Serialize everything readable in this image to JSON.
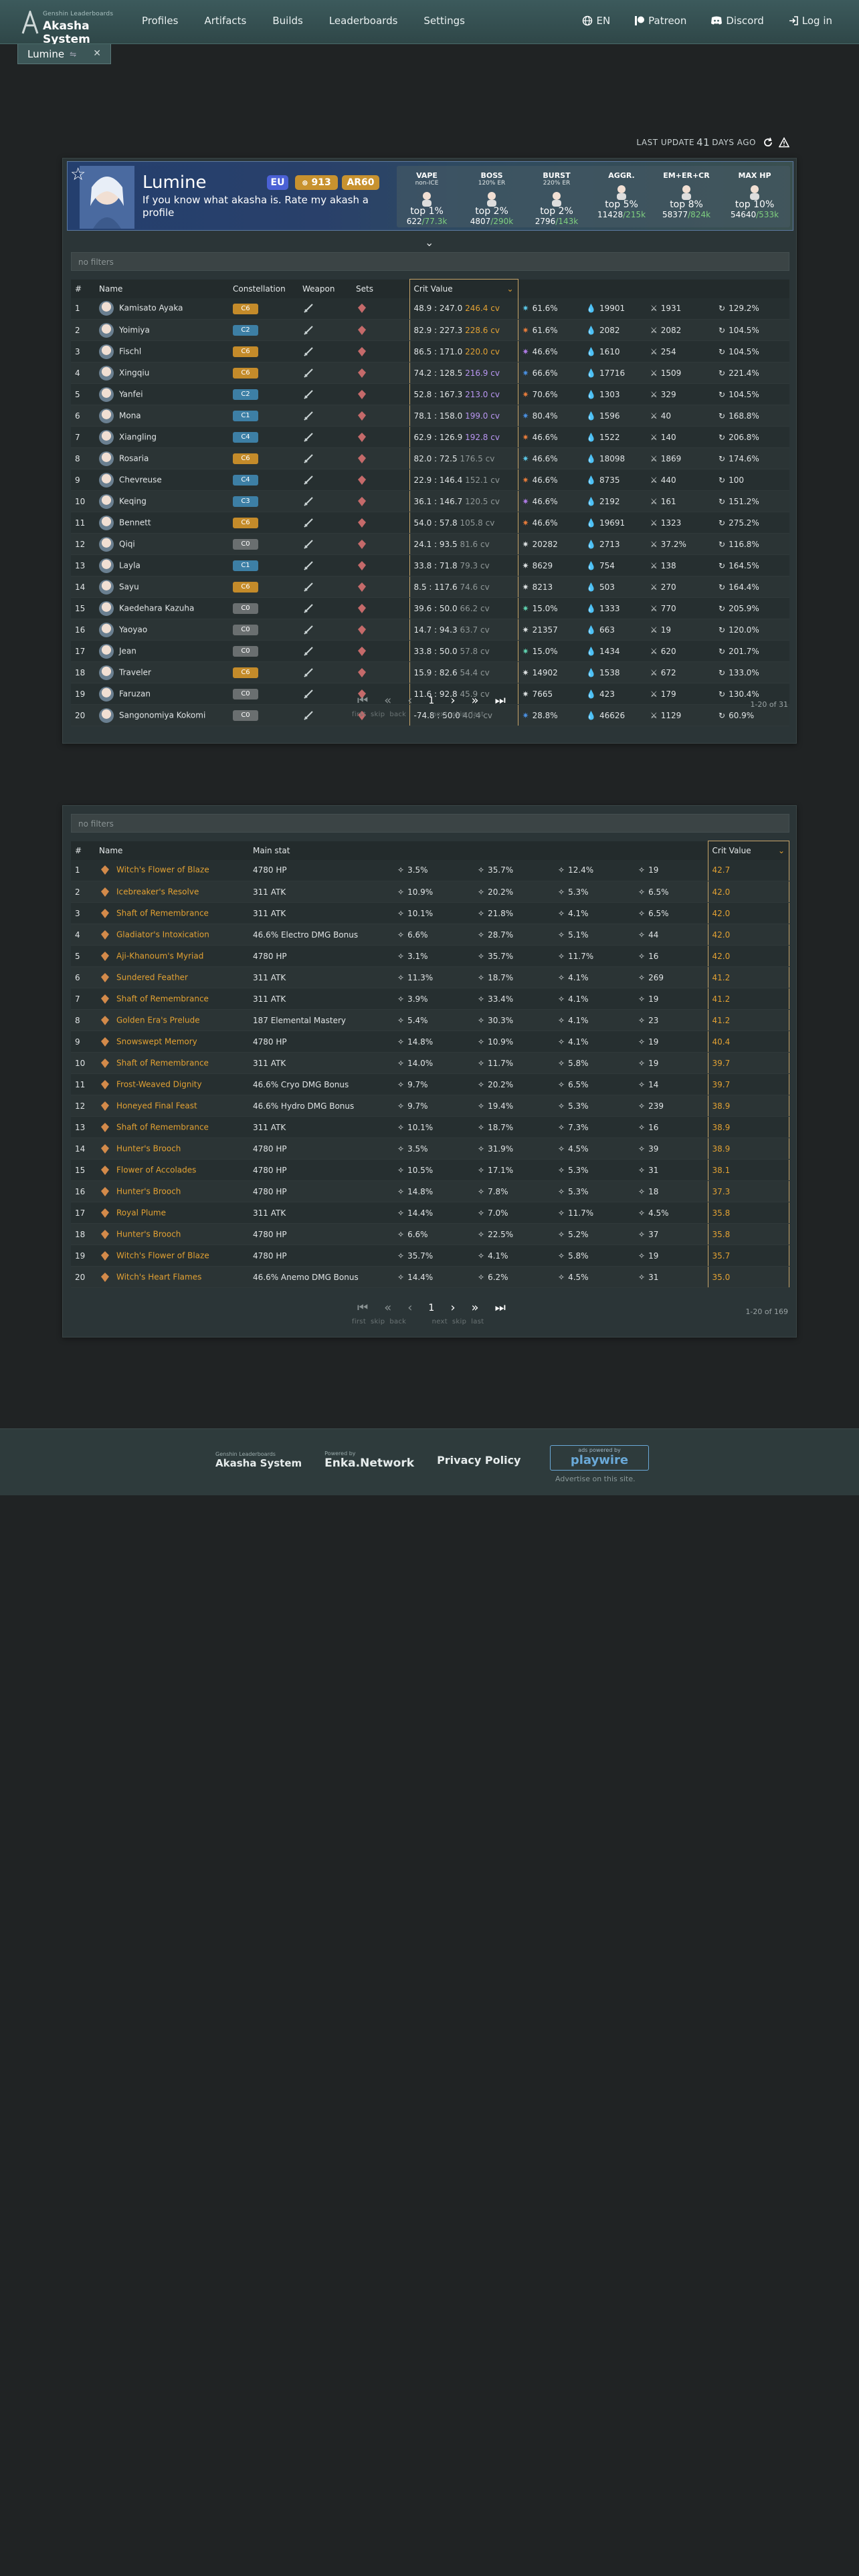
{
  "nav": {
    "logo_sup": "Genshin Leaderboards",
    "logo_main": "Akasha System",
    "links": [
      "Profiles",
      "Artifacts",
      "Builds",
      "Leaderboards",
      "Settings"
    ],
    "right": [
      "EN",
      "Patreon",
      "Discord",
      "Log in"
    ]
  },
  "tab": {
    "label": "Lumine"
  },
  "update": {
    "prefix": "LAST UPDATE",
    "value": "41",
    "suffix": "DAYS AGO"
  },
  "profile": {
    "name": "Lumine",
    "region": "EU",
    "achievements": "913",
    "ar": "AR60",
    "text": "If you know what akasha is. Rate my akash a profile",
    "stats": [
      {
        "title": "VAPE",
        "sub": "non-ICE",
        "top": "top 1%",
        "rank": "622",
        "rank_total": "/77.3k"
      },
      {
        "title": "BOSS",
        "sub": "120% ER",
        "top": "top 2%",
        "rank": "4807",
        "rank_total": "/290k"
      },
      {
        "title": "BURST",
        "sub": "220% ER",
        "top": "top 2%",
        "rank": "2796",
        "rank_total": "/143k"
      },
      {
        "title": "AGGR.",
        "sub": "",
        "top": "top 5%",
        "rank": "11428",
        "rank_total": "/215k"
      },
      {
        "title": "EM+ER+CR",
        "sub": "",
        "top": "top 8%",
        "rank": "58377",
        "rank_total": "/824k"
      },
      {
        "title": "MAX HP",
        "sub": "",
        "top": "top 10%",
        "rank": "54640",
        "rank_total": "/533k"
      }
    ]
  },
  "filter1": "no filters",
  "chars": {
    "headers": [
      "#",
      "Name",
      "Constellation",
      "Weapon",
      "Sets",
      "Crit Value",
      "",
      "",
      "",
      ""
    ],
    "rows": [
      {
        "n": "1",
        "name": "Kamisato Ayaka",
        "c": "C6",
        "cv": "48.9 : 247.0",
        "cvv": "246.4 cv",
        "cvc": "gold",
        "e": "61.6%",
        "hp": "19901",
        "atk": "1931",
        "er": "129.2%",
        "ec": "#5bc8e8"
      },
      {
        "n": "2",
        "name": "Yoimiya",
        "c": "C2",
        "cv": "82.9 : 227.3",
        "cvv": "228.6 cv",
        "cvc": "gold",
        "e": "61.6%",
        "hp": "2082",
        "atk": "2082",
        "er": "104.5%",
        "ec": "#e87c3b"
      },
      {
        "n": "3",
        "name": "Fischl",
        "c": "C6",
        "cv": "86.5 : 171.0",
        "cvv": "220.0 cv",
        "cvc": "gold",
        "e": "46.6%",
        "hp": "1610",
        "atk": "254",
        "er": "104.5%",
        "ec": "#b07be8"
      },
      {
        "n": "4",
        "name": "Xingqiu",
        "c": "C6",
        "cv": "74.2 : 128.5",
        "cvv": "216.9 cv",
        "cvc": "pur",
        "e": "66.6%",
        "hp": "17716",
        "atk": "1509",
        "er": "221.4%",
        "ec": "#4a90e2"
      },
      {
        "n": "5",
        "name": "Yanfei",
        "c": "C2",
        "cv": "52.8 : 167.3",
        "cvv": "213.0 cv",
        "cvc": "pur",
        "e": "70.6%",
        "hp": "1303",
        "atk": "329",
        "er": "104.5%",
        "ec": "#e87c3b"
      },
      {
        "n": "6",
        "name": "Mona",
        "c": "C1",
        "cv": "78.1 : 158.0",
        "cvv": "199.0 cv",
        "cvc": "pur",
        "e": "80.4%",
        "hp": "1596",
        "atk": "40",
        "er": "168.8%",
        "ec": "#4a90e2"
      },
      {
        "n": "7",
        "name": "Xiangling",
        "c": "C4",
        "cv": "62.9 : 126.9",
        "cvv": "192.8 cv",
        "cvc": "pur",
        "e": "46.6%",
        "hp": "1522",
        "atk": "140",
        "er": "206.8%",
        "ec": "#e87c3b"
      },
      {
        "n": "8",
        "name": "Rosaria",
        "c": "C6",
        "cv": "82.0 : 72.5",
        "cvv": "176.5 cv",
        "cvc": "grey",
        "e": "46.6%",
        "hp": "18098",
        "atk": "1869",
        "er": "174.6%",
        "ec": "#5bc8e8"
      },
      {
        "n": "9",
        "name": "Chevreuse",
        "c": "C4",
        "cv": "22.9 : 146.4",
        "cvv": "152.1 cv",
        "cvc": "grey",
        "e": "46.6%",
        "hp": "8735",
        "atk": "440",
        "er": "100",
        "ec": "#e87c3b"
      },
      {
        "n": "10",
        "name": "Keqing",
        "c": "C3",
        "cv": "36.1 : 146.7",
        "cvv": "120.5 cv",
        "cvc": "grey",
        "e": "46.6%",
        "hp": "2192",
        "atk": "161",
        "er": "151.2%",
        "ec": "#b07be8"
      },
      {
        "n": "11",
        "name": "Bennett",
        "c": "C6",
        "cv": "54.0 : 57.8",
        "cvv": "105.8 cv",
        "cvc": "grey",
        "e": "46.6%",
        "hp": "19691",
        "atk": "1323",
        "er": "275.2%",
        "ec": "#e87c3b"
      },
      {
        "n": "12",
        "name": "Qiqi",
        "c": "C0",
        "cv": "24.1 : 93.5",
        "cvv": "81.6 cv",
        "cvc": "grey",
        "e": "20282",
        "hp": "2713",
        "atk": "37.2%",
        "er": "116.8%",
        "ec": "#dfe3e4"
      },
      {
        "n": "13",
        "name": "Layla",
        "c": "C1",
        "cv": "33.8 : 71.8",
        "cvv": "79.3 cv",
        "cvc": "grey",
        "e": "8629",
        "hp": "754",
        "atk": "138",
        "er": "164.5%",
        "ec": "#dfe3e4"
      },
      {
        "n": "14",
        "name": "Sayu",
        "c": "C6",
        "cv": "8.5 : 117.6",
        "cvv": "74.6 cv",
        "cvc": "grey",
        "e": "8213",
        "hp": "503",
        "atk": "270",
        "er": "164.4%",
        "ec": "#dfe3e4"
      },
      {
        "n": "15",
        "name": "Kaedehara Kazuha",
        "c": "C0",
        "cv": "39.6 : 50.0",
        "cvv": "66.2 cv",
        "cvc": "grey",
        "e": "15.0%",
        "hp": "1333",
        "atk": "770",
        "er": "205.9%",
        "ec": "#5fd3b0"
      },
      {
        "n": "16",
        "name": "Yaoyao",
        "c": "C0",
        "cv": "14.7 : 94.3",
        "cvv": "63.7 cv",
        "cvc": "grey",
        "e": "21357",
        "hp": "663",
        "atk": "19",
        "er": "120.0%",
        "ec": "#dfe3e4"
      },
      {
        "n": "17",
        "name": "Jean",
        "c": "C0",
        "cv": "33.8 : 50.0",
        "cvv": "57.8 cv",
        "cvc": "grey",
        "e": "15.0%",
        "hp": "1434",
        "atk": "620",
        "er": "201.7%",
        "ec": "#5fd3b0"
      },
      {
        "n": "18",
        "name": "Traveler",
        "c": "C6",
        "cv": "15.9 : 82.6",
        "cvv": "54.4 cv",
        "cvc": "grey",
        "e": "14902",
        "hp": "1538",
        "atk": "672",
        "er": "133.0%",
        "ec": "#dfe3e4"
      },
      {
        "n": "19",
        "name": "Faruzan",
        "c": "C0",
        "cv": "11.6 : 92.8",
        "cvv": "45.9 cv",
        "cvc": "grey",
        "e": "7665",
        "hp": "423",
        "atk": "179",
        "er": "130.4%",
        "ec": "#dfe3e4"
      },
      {
        "n": "20",
        "name": "Sangonomiya Kokomi",
        "c": "C0",
        "cv": "-74.8 : 50.0",
        "cvv": "40.4 cv",
        "cvc": "grey",
        "e": "28.8%",
        "hp": "46626",
        "atk": "1129",
        "er": "60.9%",
        "ec": "#4a90e2"
      }
    ],
    "count": "1-20 of 31"
  },
  "pagination": {
    "page": "1",
    "labels": [
      "first",
      "skip",
      "back",
      "next",
      "skip",
      "last"
    ]
  },
  "filter2": "no filters",
  "arts": {
    "headers": [
      "#",
      "Name",
      "Main stat",
      "",
      "",
      "",
      "",
      "Crit Value"
    ],
    "rows": [
      {
        "n": "1",
        "name": "Witch's Flower of Blaze",
        "main": "4780 HP",
        "s1": "3.5%",
        "s2": "35.7%",
        "s3": "12.4%",
        "s4": "19",
        "cv": "42.7"
      },
      {
        "n": "2",
        "name": "Icebreaker's Resolve",
        "main": "311 ATK",
        "s1": "10.9%",
        "s2": "20.2%",
        "s3": "5.3%",
        "s4": "6.5%",
        "cv": "42.0"
      },
      {
        "n": "3",
        "name": "Shaft of Remembrance",
        "main": "311 ATK",
        "s1": "10.1%",
        "s2": "21.8%",
        "s3": "4.1%",
        "s4": "6.5%",
        "cv": "42.0"
      },
      {
        "n": "4",
        "name": "Gladiator's Intoxication",
        "main": "46.6% Electro DMG Bonus",
        "s1": "6.6%",
        "s2": "28.7%",
        "s3": "5.1%",
        "s4": "44",
        "cv": "42.0"
      },
      {
        "n": "5",
        "name": "Aji-Khanoum's Myriad",
        "main": "4780 HP",
        "s1": "3.1%",
        "s2": "35.7%",
        "s3": "11.7%",
        "s4": "16",
        "cv": "42.0"
      },
      {
        "n": "6",
        "name": "Sundered Feather",
        "main": "311 ATK",
        "s1": "11.3%",
        "s2": "18.7%",
        "s3": "4.1%",
        "s4": "269",
        "cv": "41.2"
      },
      {
        "n": "7",
        "name": "Shaft of Remembrance",
        "main": "311 ATK",
        "s1": "3.9%",
        "s2": "33.4%",
        "s3": "4.1%",
        "s4": "19",
        "cv": "41.2"
      },
      {
        "n": "8",
        "name": "Golden Era's Prelude",
        "main": "187 Elemental Mastery",
        "s1": "5.4%",
        "s2": "30.3%",
        "s3": "4.1%",
        "s4": "23",
        "cv": "41.2"
      },
      {
        "n": "9",
        "name": "Snowswept Memory",
        "main": "4780 HP",
        "s1": "14.8%",
        "s2": "10.9%",
        "s3": "4.1%",
        "s4": "19",
        "cv": "40.4"
      },
      {
        "n": "10",
        "name": "Shaft of Remembrance",
        "main": "311 ATK",
        "s1": "14.0%",
        "s2": "11.7%",
        "s3": "5.8%",
        "s4": "19",
        "cv": "39.7"
      },
      {
        "n": "11",
        "name": "Frost-Weaved Dignity",
        "main": "46.6% Cryo DMG Bonus",
        "s1": "9.7%",
        "s2": "20.2%",
        "s3": "6.5%",
        "s4": "14",
        "cv": "39.7"
      },
      {
        "n": "12",
        "name": "Honeyed Final Feast",
        "main": "46.6% Hydro DMG Bonus",
        "s1": "9.7%",
        "s2": "19.4%",
        "s3": "5.3%",
        "s4": "239",
        "cv": "38.9"
      },
      {
        "n": "13",
        "name": "Shaft of Remembrance",
        "main": "311 ATK",
        "s1": "10.1%",
        "s2": "18.7%",
        "s3": "7.3%",
        "s4": "16",
        "cv": "38.9"
      },
      {
        "n": "14",
        "name": "Hunter's Brooch",
        "main": "4780 HP",
        "s1": "3.5%",
        "s2": "31.9%",
        "s3": "4.5%",
        "s4": "39",
        "cv": "38.9"
      },
      {
        "n": "15",
        "name": "Flower of Accolades",
        "main": "4780 HP",
        "s1": "10.5%",
        "s2": "17.1%",
        "s3": "5.3%",
        "s4": "31",
        "cv": "38.1"
      },
      {
        "n": "16",
        "name": "Hunter's Brooch",
        "main": "4780 HP",
        "s1": "14.8%",
        "s2": "7.8%",
        "s3": "5.3%",
        "s4": "18",
        "cv": "37.3"
      },
      {
        "n": "17",
        "name": "Royal Plume",
        "main": "311 ATK",
        "s1": "14.4%",
        "s2": "7.0%",
        "s3": "11.7%",
        "s4": "4.5%",
        "cv": "35.8"
      },
      {
        "n": "18",
        "name": "Hunter's Brooch",
        "main": "4780 HP",
        "s1": "6.6%",
        "s2": "22.5%",
        "s3": "5.2%",
        "s4": "37",
        "cv": "35.8"
      },
      {
        "n": "19",
        "name": "Witch's Flower of Blaze",
        "main": "4780 HP",
        "s1": "35.7%",
        "s2": "4.1%",
        "s3": "5.8%",
        "s4": "19",
        "cv": "35.7"
      },
      {
        "n": "20",
        "name": "Witch's Heart Flames",
        "main": "46.6% Anemo DMG Bonus",
        "s1": "14.4%",
        "s2": "6.2%",
        "s3": "4.5%",
        "s4": "31",
        "cv": "35.0"
      }
    ],
    "count": "1-20 of 169"
  },
  "footer": {
    "akasha_sup": "Genshin Leaderboards",
    "akasha": "Akasha System",
    "enka_sup": "Powered by",
    "enka": "Enka.Network",
    "privacy": "Privacy Policy",
    "ads_by": "ads powered by",
    "playwire": "playwire",
    "advertise": "Advertise on this site."
  },
  "colors": {
    "accent": "#e2a133",
    "element_purple": "#b996f2",
    "nav_bg": "#3c5a5c"
  }
}
